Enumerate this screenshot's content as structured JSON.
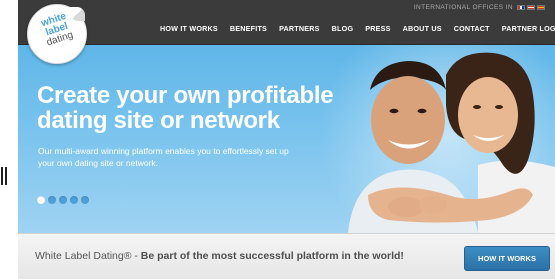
{
  "header": {
    "international_label": "INTERNATIONAL OFFICES IN",
    "flags": [
      "uk-flag-icon",
      "us-flag-icon",
      "es-flag-icon"
    ],
    "nav": [
      {
        "label": "HOW IT WORKS"
      },
      {
        "label": "BENEFITS"
      },
      {
        "label": "PARTNERS"
      },
      {
        "label": "BLOG"
      },
      {
        "label": "PRESS"
      },
      {
        "label": "ABOUT US"
      },
      {
        "label": "CONTACT"
      },
      {
        "label": "PARTNER LOGIN"
      }
    ]
  },
  "logo": {
    "line1": "white",
    "line2": "label",
    "line3": "dating"
  },
  "hero": {
    "headline_line1": "Create your own profitable",
    "headline_line2": "dating site or network",
    "subtext_line1": "Our multi-award winning platform enables you to effortlessly set up",
    "subtext_line2": "your own dating site or network.",
    "slide_count": 5,
    "active_slide": 1
  },
  "bottom": {
    "tagline_brand": "White Label Dating® - ",
    "tagline_rest": "Be part of the most successful platform in the world!",
    "cta_label": "HOW IT WORKS"
  },
  "colors": {
    "nav_bg": "#3b3b3b",
    "hero_blue": "#6dbdeb",
    "cta_blue": "#2f7ab3"
  }
}
